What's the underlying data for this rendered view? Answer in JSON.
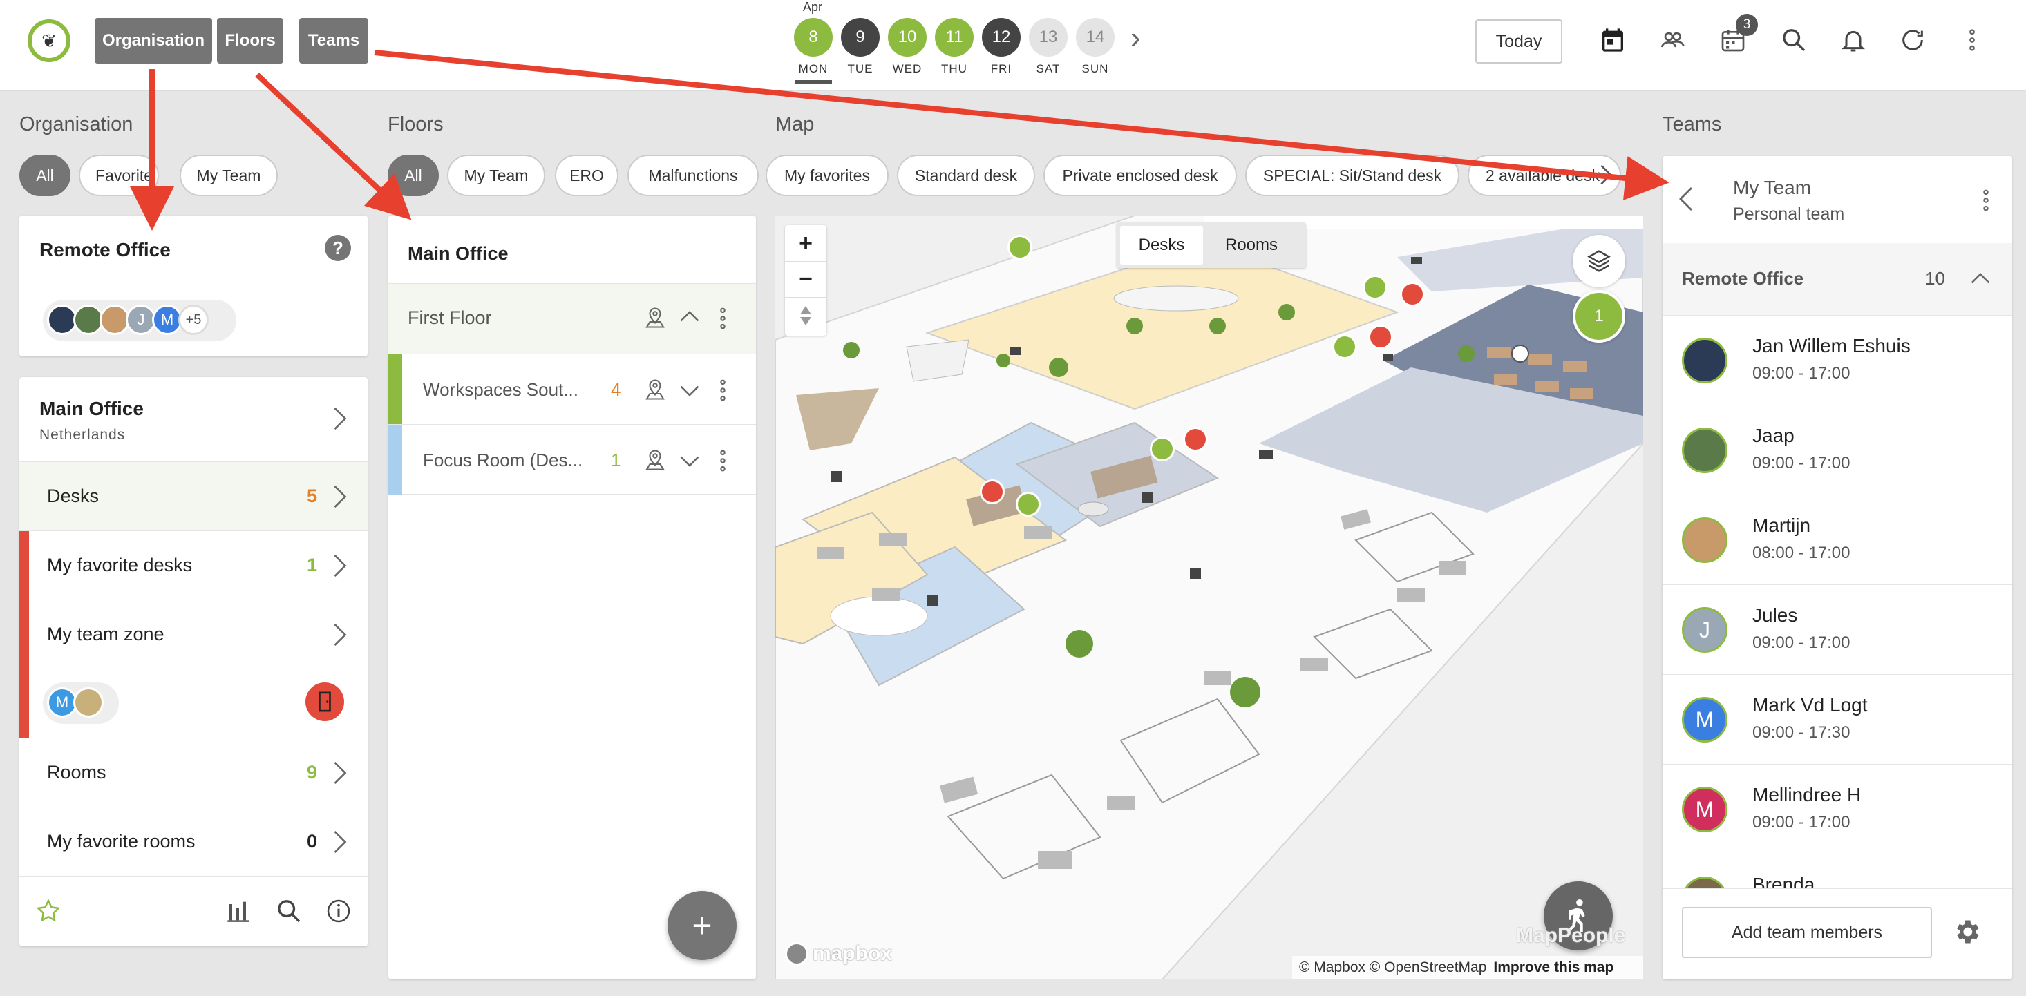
{
  "topbar": {
    "logo_glyph": "❦",
    "nav": [
      "Organisation",
      "Floors",
      "Teams"
    ],
    "month": "Apr",
    "days": [
      {
        "num": "8",
        "name": "MON",
        "color": "#8dbb3f",
        "dot": "#e24b3b",
        "selected": true
      },
      {
        "num": "9",
        "name": "TUE",
        "color": "#444444"
      },
      {
        "num": "10",
        "name": "WED",
        "color": "#8dbb3f",
        "dot": "#3b7ee2"
      },
      {
        "num": "11",
        "name": "THU",
        "color": "#8dbb3f",
        "dot": "#3b7ee2"
      },
      {
        "num": "12",
        "name": "FRI",
        "color": "#444444"
      },
      {
        "num": "13",
        "name": "SAT",
        "color": "#e4e4e4"
      },
      {
        "num": "14",
        "name": "SUN",
        "color": "#e4e4e4"
      }
    ],
    "next_glyph": "›",
    "today": "Today",
    "calendar_badge": "3"
  },
  "organisation": {
    "title": "Organisation",
    "chips": [
      "All",
      "Favorite",
      "My Team"
    ],
    "remote": {
      "name": "Remote Office",
      "help": "?",
      "more": "+5",
      "avatars": [
        "",
        "",
        "",
        "J",
        "M"
      ]
    },
    "main": {
      "name": "Main Office",
      "country": "Netherlands",
      "rows": [
        {
          "label": "Desks",
          "count": "5",
          "color": "#e67e22"
        },
        {
          "label": "My favorite desks",
          "count": "1",
          "color": "#8dbb3f"
        },
        {
          "label": "My team zone",
          "count": ""
        },
        {
          "label": "Rooms",
          "count": "9",
          "color": "#8dbb3f"
        },
        {
          "label": "My favorite rooms",
          "count": "0",
          "color": "#222222"
        }
      ],
      "zone_avatars": [
        "M",
        ""
      ]
    }
  },
  "floors": {
    "title": "Floors",
    "chips": [
      "All",
      "My Team",
      "ERO",
      "Malfunctions",
      "My favorites",
      "Standard desk",
      "Private enclosed desk",
      "SPECIAL: Sit/Stand desk",
      "2 available desk"
    ],
    "office": "Main Office",
    "floor": "First Floor",
    "zones": [
      {
        "name": "Workspaces Sout...",
        "count": "4",
        "color": "#8dbb3f",
        "countColor": "#e67e22"
      },
      {
        "name": "Focus Room (Des...",
        "count": "1",
        "color": "#a9cfef",
        "countColor": "#8dbb3f"
      }
    ],
    "add": "+"
  },
  "map": {
    "title": "Map",
    "toggle": [
      "Desks",
      "Rooms"
    ],
    "zoom_in": "+",
    "zoom_out": "−",
    "layer_count": "1",
    "brand": "mapbox",
    "attribution": "© Mapbox © OpenStreetMap",
    "improve": "Improve this map",
    "watermark": "MapPeople"
  },
  "teams": {
    "title": "Teams",
    "team": "My Team",
    "subtitle": "Personal team",
    "group": "Remote Office",
    "group_count": "10",
    "members": [
      {
        "name": "Jan Willem Eshuis",
        "time": "09:00 - 17:00",
        "color": "#2b3a55",
        "initial": ""
      },
      {
        "name": "Jaap",
        "time": "09:00 - 17:00",
        "color": "#5a7a4a",
        "initial": ""
      },
      {
        "name": "Martijn",
        "time": "08:00 - 17:00",
        "color": "#c89a6a",
        "initial": ""
      },
      {
        "name": "Jules",
        "time": "09:00 - 17:00",
        "color": "#9aa7b4",
        "initial": "J"
      },
      {
        "name": "Mark Vd Logt",
        "time": "09:00 - 17:30",
        "color": "#3b7ee2",
        "initial": "M"
      },
      {
        "name": "Mellindree H",
        "time": "09:00 - 17:00",
        "color": "#d02f5e",
        "initial": "M"
      },
      {
        "name": "Brenda",
        "time": "",
        "color": "#7a6a4a",
        "initial": ""
      }
    ],
    "add_members": "Add team members"
  }
}
